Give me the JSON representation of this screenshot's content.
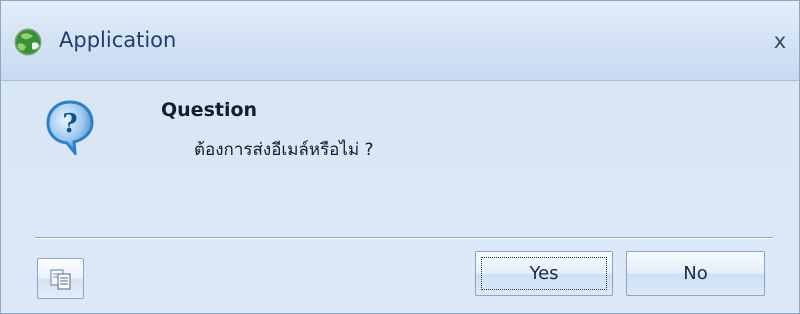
{
  "window": {
    "title": "Application",
    "close_label": "x"
  },
  "message": {
    "heading": "Question",
    "text": "ต้องการส่งอีเมล์หรือไม่ ?"
  },
  "buttons": {
    "yes": "Yes",
    "no": "No"
  },
  "icons": {
    "app": "app-globe-icon",
    "question": "question-icon",
    "copy": "copy-icon"
  },
  "colors": {
    "title_text": "#1e3f6e",
    "dialog_body": "#d9e7f7",
    "button_face": "#e4eefa",
    "question_icon_blue": "#2f7fc8"
  }
}
